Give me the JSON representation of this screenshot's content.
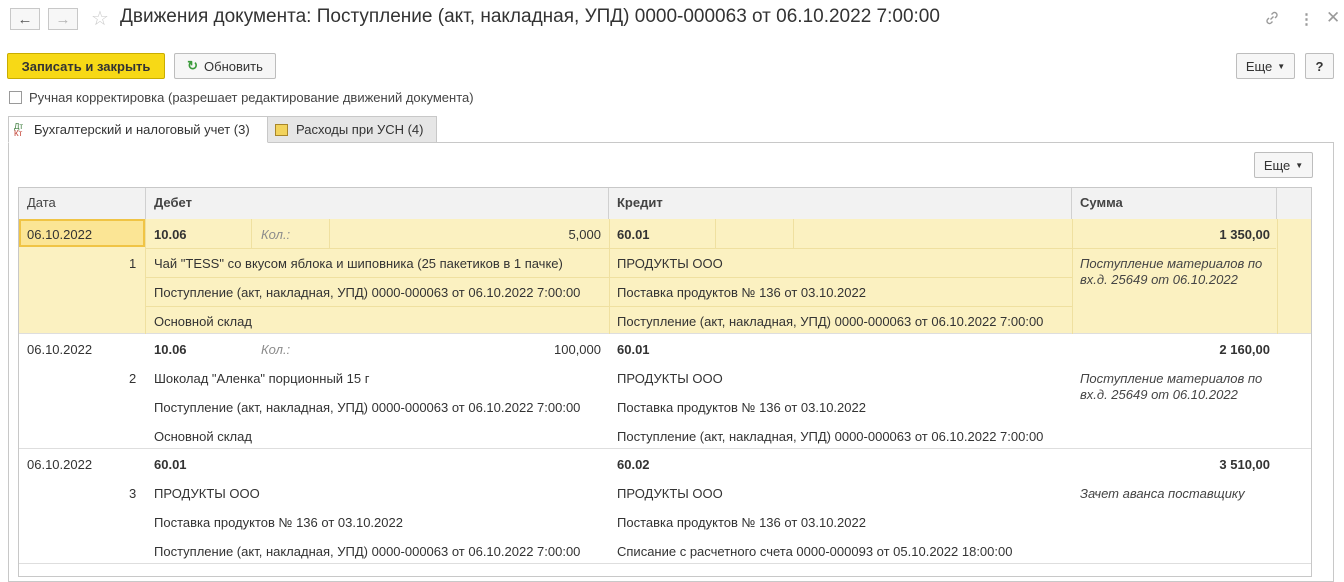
{
  "window": {
    "title": "Движения документа: Поступление (акт, накладная, УПД) 0000-000063 от 06.10.2022 7:00:00"
  },
  "toolbar": {
    "save_close": "Записать и закрыть",
    "refresh": "Обновить",
    "more": "Еще",
    "help": "?"
  },
  "manual_adjust": {
    "label": "Ручная корректировка (разрешает редактирование движений документа)",
    "checked": false
  },
  "tabs": [
    {
      "label": "Бухгалтерский и налоговый учет (3)",
      "icon": "dt-kt-icon",
      "active": true
    },
    {
      "label": "Расходы при УСН (4)",
      "icon": "register-icon",
      "active": false
    }
  ],
  "panel": {
    "more": "Еще"
  },
  "table": {
    "columns": [
      "Дата",
      "Дебет",
      "Кредит",
      "Сумма"
    ],
    "qty_label": "Кол.:",
    "rows": [
      {
        "date": "06.10.2022",
        "num": "1",
        "debit_account": "10.06",
        "debit_qty": "5,000",
        "debit_sub": [
          "Чай \"TESS\" со вкусом яблока и шиповника (25 пакетиков в 1 пачке)",
          "Поступление (акт, накладная, УПД) 0000-000063 от 06.10.2022 7:00:00",
          "Основной склад"
        ],
        "credit_account": "60.01",
        "credit_sub": [
          "ПРОДУКТЫ ООО",
          "Поставка продуктов № 136 от 03.10.2022",
          "Поступление (акт, накладная, УПД) 0000-000063 от 06.10.2022 7:00:00"
        ],
        "amount": "1 350,00",
        "content": "Поступление материалов по вх.д. 25649 от 06.10.2022"
      },
      {
        "date": "06.10.2022",
        "num": "2",
        "debit_account": "10.06",
        "debit_qty": "100,000",
        "debit_sub": [
          "Шоколад \"Аленка\" порционный 15 г",
          "Поступление (акт, накладная, УПД) 0000-000063 от 06.10.2022 7:00:00",
          "Основной склад"
        ],
        "credit_account": "60.01",
        "credit_sub": [
          "ПРОДУКТЫ ООО",
          "Поставка продуктов № 136 от 03.10.2022",
          "Поступление (акт, накладная, УПД) 0000-000063 от 06.10.2022 7:00:00"
        ],
        "amount": "2 160,00",
        "content": "Поступление материалов по вх.д. 25649 от 06.10.2022"
      },
      {
        "date": "06.10.2022",
        "num": "3",
        "debit_account": "60.01",
        "debit_qty": "",
        "debit_sub": [
          "ПРОДУКТЫ ООО",
          "Поставка продуктов № 136 от 03.10.2022",
          "Поступление (акт, накладная, УПД) 0000-000063 от 06.10.2022 7:00:00"
        ],
        "credit_account": "60.02",
        "credit_sub": [
          "ПРОДУКТЫ ООО",
          "Поставка продуктов № 136 от 03.10.2022",
          "Списание с расчетного счета 0000-000093 от 05.10.2022 18:00:00"
        ],
        "amount": "3 510,00",
        "content": "Зачет аванса поставщику"
      }
    ]
  },
  "colors": {
    "accent_yellow": "#f7d916",
    "selection": "#fbf1c1"
  }
}
